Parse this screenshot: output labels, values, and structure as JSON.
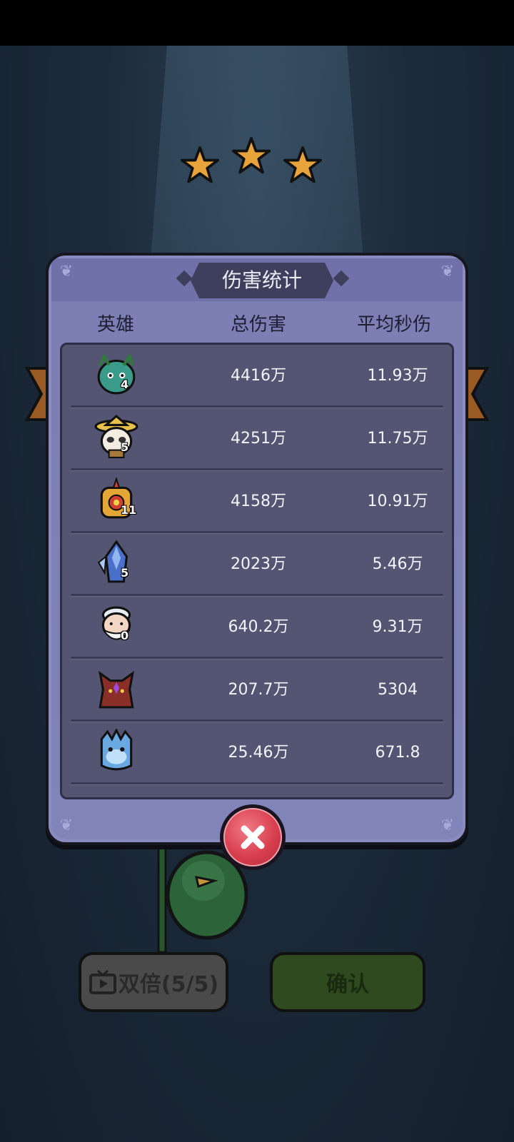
{
  "dialog": {
    "title": "伤害统计",
    "columns": {
      "hero": "英雄",
      "total": "总伤害",
      "avg": "平均秒伤"
    }
  },
  "rows": [
    {
      "icon": "green-dragon-hero-avatar",
      "level": "4",
      "total": "4416万",
      "avg": "11.93万"
    },
    {
      "icon": "panda-straw-hat-hero-avatar",
      "level": "5",
      "total": "4251万",
      "avg": "11.75万"
    },
    {
      "icon": "golden-armor-hero-avatar",
      "level": "11",
      "total": "4158万",
      "avg": "10.91万"
    },
    {
      "icon": "blue-crystal-knight-avatar",
      "level": "5",
      "total": "2023万",
      "avg": "5.46万"
    },
    {
      "icon": "white-beard-elder-avatar",
      "level": "0",
      "total": "640.2万",
      "avg": "9.31万"
    },
    {
      "icon": "red-dragon-avatar",
      "level": "",
      "total": "207.7万",
      "avg": "5304"
    },
    {
      "icon": "ice-dragon-avatar",
      "level": "",
      "total": "25.46万",
      "avg": "671.8"
    }
  ],
  "stars": {
    "earned": 3,
    "total": 3
  },
  "buttons": {
    "double_label": "双倍(5/5)",
    "confirm_label": "确认"
  },
  "colors": {
    "accent_close": "#d9404f",
    "modal": "#8184b8",
    "table": "#535573",
    "star": "#e8a33a"
  }
}
